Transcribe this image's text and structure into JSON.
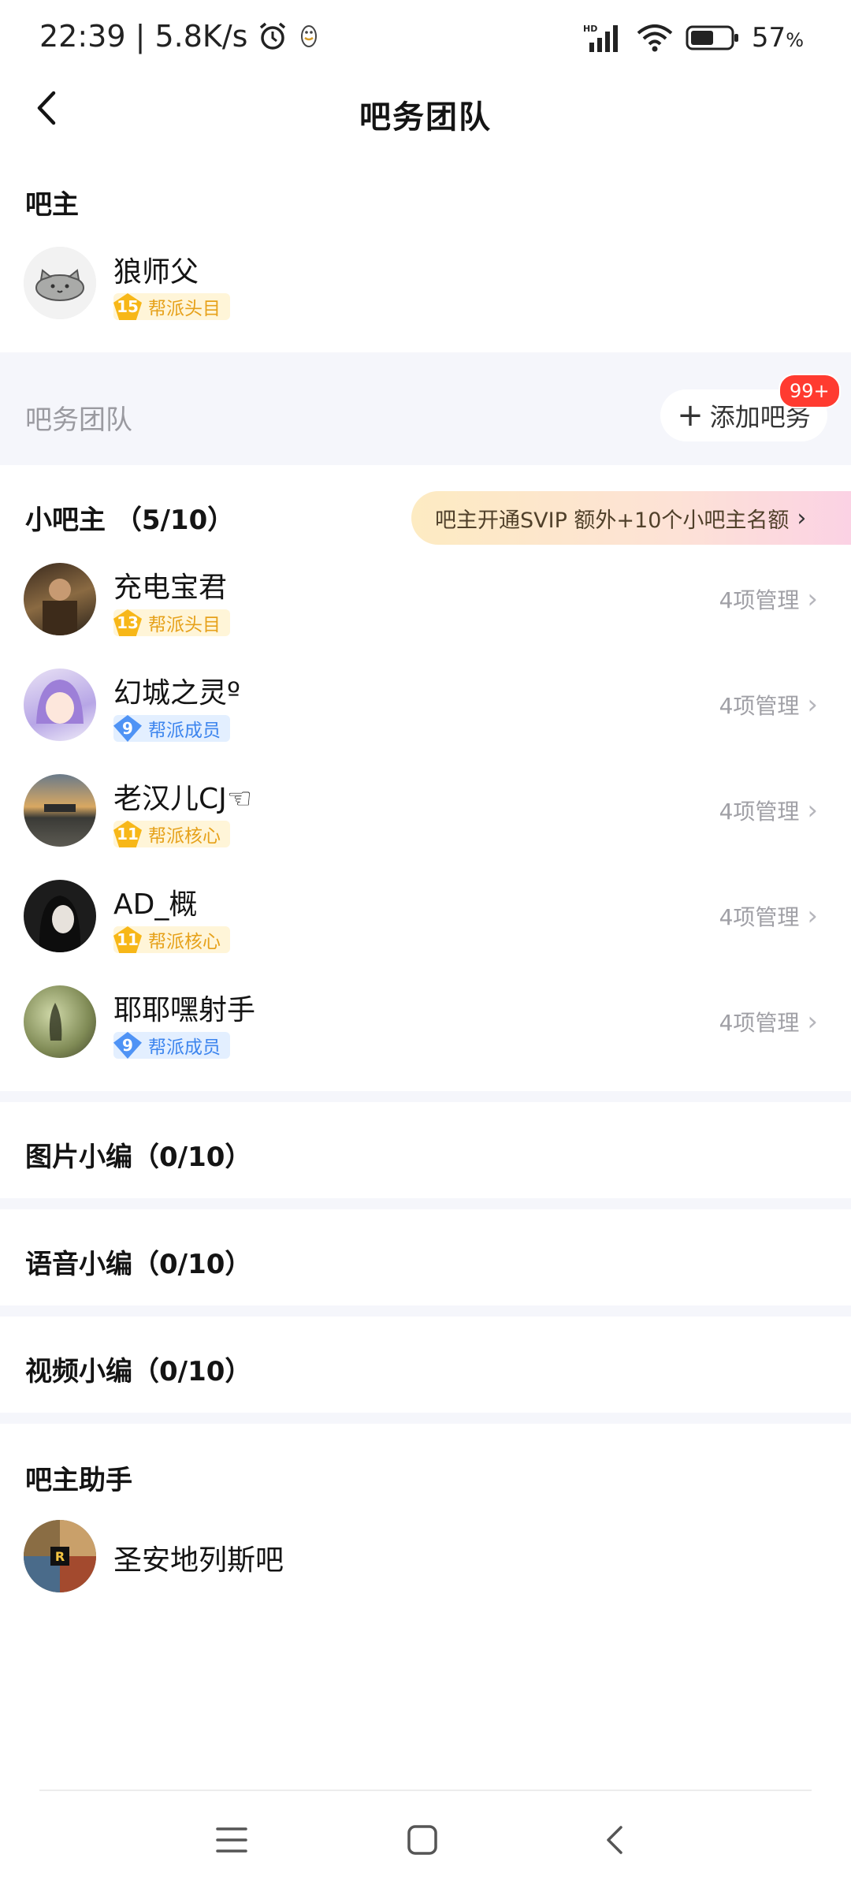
{
  "status_bar": {
    "time_speed": "22:39 | 5.8K/s",
    "battery": "57",
    "battery_unit": "%",
    "alarm_icon": "alarm-clock-icon",
    "qq_icon": "qq-penguin-icon",
    "signal_label": "HD"
  },
  "header": {
    "title": "吧务团队",
    "back_icon": "back-arrow-icon"
  },
  "owner_section": {
    "title": "吧主",
    "user": {
      "name": "狼师父",
      "level": "15",
      "badge": "帮派头目",
      "badge_type": "gold"
    }
  },
  "team_band": {
    "label": "吧务团队",
    "add_button": "添加吧务",
    "notification_count": "99+"
  },
  "sub_owners": {
    "title": "小吧主 （5/10）",
    "promo": "吧主开通SVIP 额外+10个小吧主名额",
    "members": [
      {
        "name": "充电宝君",
        "level": "13",
        "badge": "帮派头目",
        "badge_type": "gold",
        "manage": "4项管理"
      },
      {
        "name": "幻城之灵º",
        "level": "9",
        "badge": "帮派成员",
        "badge_type": "blue",
        "manage": "4项管理"
      },
      {
        "name": "老汉儿CJ☜",
        "level": "11",
        "badge": "帮派核心",
        "badge_type": "gold",
        "manage": "4项管理"
      },
      {
        "name": "AD_概",
        "level": "11",
        "badge": "帮派核心",
        "badge_type": "gold",
        "manage": "4项管理"
      },
      {
        "name": "耶耶嘿射手",
        "level": "9",
        "badge": "帮派成员",
        "badge_type": "blue",
        "manage": "4项管理"
      }
    ]
  },
  "editor_sections": [
    {
      "title": "图片小编（0/10）"
    },
    {
      "title": "语音小编（0/10）"
    },
    {
      "title": "视频小编（0/10）"
    }
  ],
  "assistant_section": {
    "title": "吧主助手",
    "user": {
      "name": "圣安地列斯吧"
    }
  },
  "nav_bar": {
    "menu_icon": "menu-icon",
    "home_icon": "home-square-icon",
    "back_icon": "nav-back-icon"
  },
  "colors": {
    "band": "#f5f6fb",
    "gold_badge": "#f7b718",
    "blue_badge": "#4f93f5",
    "red_badge": "#ff3b30"
  }
}
